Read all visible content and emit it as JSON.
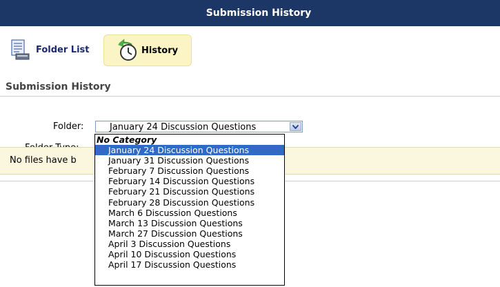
{
  "header": {
    "title": "Submission History"
  },
  "toolbar": {
    "folder_list": "Folder List",
    "history": "History"
  },
  "section": {
    "title": "Submission History"
  },
  "form": {
    "folder_label": "Folder:",
    "folder_type_label": "Folder Type:",
    "folder_value": "January 24 Discussion Questions"
  },
  "notice": {
    "text_visible": "No files have b"
  },
  "dropdown": {
    "group_label": "No Category",
    "options": [
      "January 24 Discussion Questions",
      "January 31 Discussion Questions",
      "February 7 Discussion Questions",
      "February 14 Discussion Questions",
      "February 21 Discussion Questions",
      "February 28 Discussion Questions",
      "March 6 Discussion Questions",
      "March 13 Discussion Questions",
      "March 27 Discussion Questions",
      "April 3 Discussion Questions",
      "April 10 Discussion Questions",
      "April 17 Discussion Questions"
    ],
    "selected_index": 0
  },
  "colors": {
    "header_bg": "#1c3765",
    "selected_bg": "#316ac5",
    "notice_bg": "#fbf6de",
    "history_bg": "#fbf4c4"
  },
  "icons": {
    "folder_list": "folder-list-icon",
    "history": "history-clock-icon",
    "dropdown_arrow": "chevron-down-icon"
  }
}
